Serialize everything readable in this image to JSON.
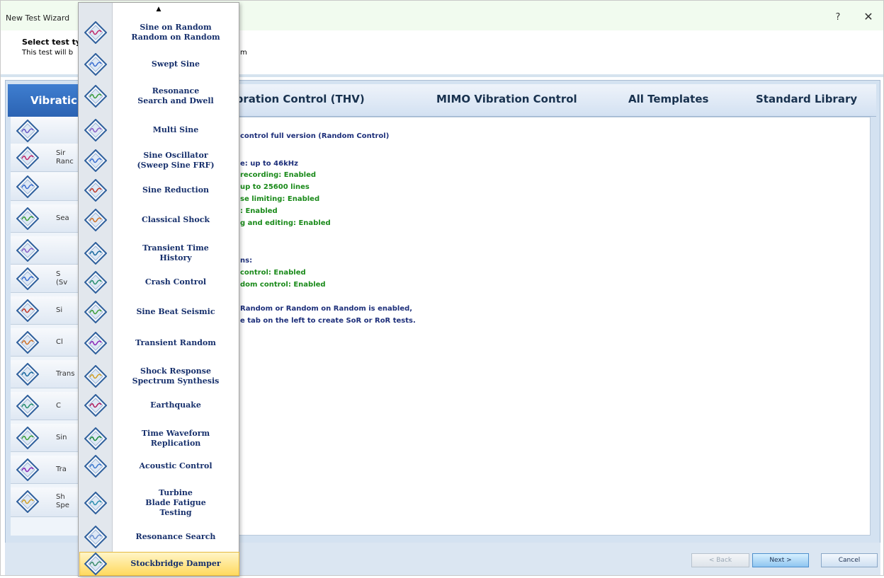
{
  "window": {
    "title": "New Test Wizard",
    "help": "?",
    "close": "✕"
  },
  "header": {
    "title": "Select test ty",
    "subtitle": "This test will b",
    "subtitle_tail": "m"
  },
  "tabs": {
    "active": "Vibratic",
    "items": [
      "-Vibration Control (THV)",
      "MIMO Vibration Control",
      "All Templates",
      "Standard Library"
    ]
  },
  "left_list": [
    {
      "label": ""
    },
    {
      "label": "Sir\nRanc"
    },
    {
      "label": ""
    },
    {
      "label": "Sea"
    },
    {
      "label": ""
    },
    {
      "label": "S\n(Sv"
    },
    {
      "label": "Si"
    },
    {
      "label": "Cl"
    },
    {
      "label": "Trans"
    },
    {
      "label": "C"
    },
    {
      "label": "Sin"
    },
    {
      "label": "Tra"
    },
    {
      "label": "Sh\nSpe"
    }
  ],
  "content": {
    "lines": [
      {
        "text": "control full version (Random Control)",
        "color": "blue"
      },
      {
        "text": "e: up to 46kHz",
        "color": "blue"
      },
      {
        "text": "recording: Enabled",
        "color": "green"
      },
      {
        "text": "up to 25600 lines",
        "color": "green"
      },
      {
        "text": "se limiting: Enabled",
        "color": "green"
      },
      {
        "text": ": Enabled",
        "color": "green"
      },
      {
        "text": "g and editing: Enabled",
        "color": "green"
      },
      {
        "text": "ns:",
        "color": "blue"
      },
      {
        "text": "control: Enabled",
        "color": "green"
      },
      {
        "text": "dom control: Enabled",
        "color": "green"
      },
      {
        "text": "Random or Random on Random is enabled,",
        "color": "blue"
      },
      {
        "text": "e tab on the left to create SoR or RoR tests.",
        "color": "blue"
      }
    ]
  },
  "menu": {
    "scroll_up": "▲",
    "items": [
      {
        "label": "Sine on Random\nRandom on Random",
        "icon": "sine-random-icon"
      },
      {
        "label": "Swept Sine",
        "icon": "swept-sine-icon"
      },
      {
        "label": "Resonance\nSearch and Dwell",
        "icon": "resonance-dwell-icon"
      },
      {
        "label": "Multi Sine",
        "icon": "multi-sine-icon"
      },
      {
        "label": "Sine Oscillator\n(Sweep Sine FRF)",
        "icon": "sine-oscillator-icon"
      },
      {
        "label": "Sine Reduction",
        "icon": "sine-reduction-icon"
      },
      {
        "label": "Classical Shock",
        "icon": "classical-shock-icon"
      },
      {
        "label": "Transient Time\nHistory",
        "icon": "transient-time-history-icon"
      },
      {
        "label": "Crash Control",
        "icon": "crash-control-icon"
      },
      {
        "label": "Sine Beat Seismic",
        "icon": "sine-beat-seismic-icon"
      },
      {
        "label": "Transient Random",
        "icon": "transient-random-icon"
      },
      {
        "label": "Shock Response\nSpectrum Synthesis",
        "icon": "srs-synthesis-icon"
      },
      {
        "label": "Earthquake",
        "icon": "earthquake-icon"
      },
      {
        "label": "Time Waveform\nReplication",
        "icon": "twr-icon"
      },
      {
        "label": "Acoustic Control",
        "icon": "acoustic-control-icon"
      },
      {
        "label": "Turbine\nBlade Fatigue\nTesting",
        "icon": "turbine-blade-icon"
      },
      {
        "label": "Resonance Search",
        "icon": "resonance-search-icon"
      },
      {
        "label": "Stockbridge Damper",
        "icon": "stockbridge-damper-icon",
        "selected": true
      }
    ]
  },
  "footer": {
    "back": "< Back",
    "next": "Next >",
    "cancel": "Cancel"
  },
  "colors": {
    "accent": "#2b63b3",
    "selection": "#ffd95e",
    "label_blue": "#17306c",
    "enabled_green": "#1a8a1a"
  }
}
